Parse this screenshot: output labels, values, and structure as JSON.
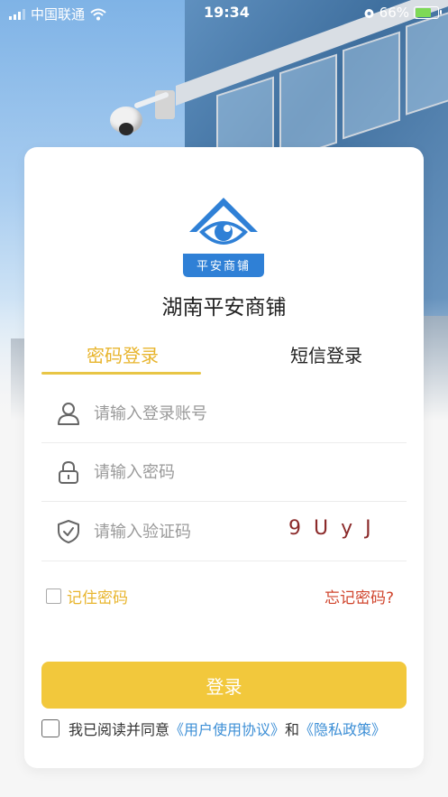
{
  "status_bar": {
    "carrier": "中国联通",
    "time": "19:34",
    "battery": "66%"
  },
  "app": {
    "logo_text": "平安商铺",
    "name": "湖南平安商铺"
  },
  "tabs": [
    {
      "label": "密码登录",
      "active": true
    },
    {
      "label": "短信登录",
      "active": false
    }
  ],
  "fields": {
    "account_placeholder": "请输入登录账号",
    "password_placeholder": "请输入密码",
    "captcha_placeholder": "请输入验证码",
    "captcha_code": "9UyJ"
  },
  "options": {
    "remember_label": "记住密码",
    "forgot_label": "忘记密码?"
  },
  "login_button": "登录",
  "agreement": {
    "prefix": "我已阅读并同意",
    "user_agreement": "《用户使用协议》",
    "conjunction": "和",
    "privacy_policy": "《隐私政策》"
  },
  "colors": {
    "accent": "#e8b52e",
    "button": "#f2c83c",
    "link": "#3d8fd6",
    "forgot": "#d0452d",
    "logo_blue": "#2f80d6"
  }
}
